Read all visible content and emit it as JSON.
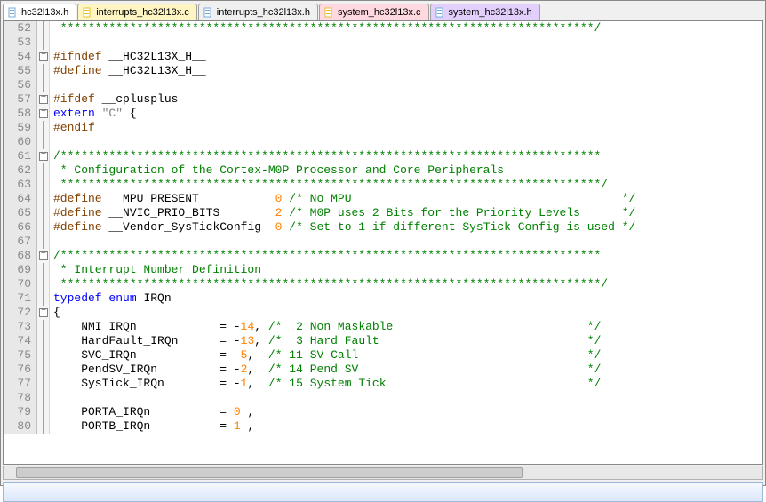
{
  "tabs": [
    {
      "label": "hc32l13x.h",
      "cls": "active",
      "iconColor": "#7aa8d8"
    },
    {
      "label": "interrupts_hc32l13x.c",
      "cls": "yellow",
      "iconColor": "#e0c030"
    },
    {
      "label": "interrupts_hc32l13x.h",
      "cls": "",
      "iconColor": "#7aa8d8"
    },
    {
      "label": "system_hc32l13x.c",
      "cls": "red",
      "iconColor": "#e0c030"
    },
    {
      "label": "system_hc32l13x.h",
      "cls": "purple",
      "iconColor": "#7aa8d8"
    }
  ],
  "lines": [
    {
      "n": 52,
      "f": "pipe",
      "html": "<span class='c-comment'> *****************************************************************************/</span>"
    },
    {
      "n": 53,
      "f": "pipe",
      "html": ""
    },
    {
      "n": 54,
      "f": "box",
      "html": "<span class='c-pp'>#ifndef</span> <span class='c-ident'>__HC32L13X_H__</span>"
    },
    {
      "n": 55,
      "f": "pipe",
      "html": "<span class='c-pp'>#define</span> <span class='c-ident'>__HC32L13X_H__</span>"
    },
    {
      "n": 56,
      "f": "pipe",
      "html": ""
    },
    {
      "n": 57,
      "f": "box",
      "html": "<span class='c-pp'>#ifdef</span> <span class='c-ident'>__cplusplus</span>"
    },
    {
      "n": 58,
      "f": "box",
      "html": "<span class='c-kw'>extern</span> <span class='c-str'>\"C\"</span> <span class='c-ident'>{</span>"
    },
    {
      "n": 59,
      "f": "pipe",
      "html": "<span class='c-pp'>#endif</span>"
    },
    {
      "n": 60,
      "f": "pipe",
      "html": ""
    },
    {
      "n": 61,
      "f": "box",
      "html": "<span class='c-comment'>/******************************************************************************</span>"
    },
    {
      "n": 62,
      "f": "pipe",
      "html": "<span class='c-comment'> * Configuration of the Cortex-M0P Processor and Core Peripherals</span>"
    },
    {
      "n": 63,
      "f": "pipe",
      "html": "<span class='c-comment'> ******************************************************************************/</span>"
    },
    {
      "n": 64,
      "f": "pipe",
      "html": "<span class='c-pp'>#define</span> <span class='c-ident'>__MPU_PRESENT           </span><span class='c-num'>0</span> <span class='c-comment'>/* No MPU                                       */</span>"
    },
    {
      "n": 65,
      "f": "pipe",
      "html": "<span class='c-pp'>#define</span> <span class='c-ident'>__NVIC_PRIO_BITS        </span><span class='c-num'>2</span> <span class='c-comment'>/* M0P uses 2 Bits for the Priority Levels      */</span>"
    },
    {
      "n": 66,
      "f": "pipe",
      "html": "<span class='c-pp'>#define</span> <span class='c-ident'>__Vendor_SysTickConfig  </span><span class='c-num'>0</span> <span class='c-comment'>/* Set to 1 if different SysTick Config is used */</span>"
    },
    {
      "n": 67,
      "f": "pipe",
      "html": ""
    },
    {
      "n": 68,
      "f": "box",
      "html": "<span class='c-comment'>/******************************************************************************</span>"
    },
    {
      "n": 69,
      "f": "pipe",
      "html": "<span class='c-comment'> * Interrupt Number Definition</span>"
    },
    {
      "n": 70,
      "f": "pipe",
      "html": "<span class='c-comment'> ******************************************************************************/</span>"
    },
    {
      "n": 71,
      "f": "pipe",
      "html": "<span class='c-kw'>typedef</span> <span class='c-kw'>enum</span> <span class='c-ident'>IRQn</span>"
    },
    {
      "n": 72,
      "f": "box",
      "html": "<span class='c-ident'>{</span>"
    },
    {
      "n": 73,
      "f": "pipe",
      "html": "<span class='c-ident'>    NMI_IRQn            </span><span class='c-ident'>=</span> <span class='c-ident'>-</span><span class='c-num'>14</span><span class='c-ident'>,</span> <span class='c-comment'>/*  2 Non Maskable                            */</span>"
    },
    {
      "n": 74,
      "f": "pipe",
      "html": "<span class='c-ident'>    HardFault_IRQn      </span><span class='c-ident'>=</span> <span class='c-ident'>-</span><span class='c-num'>13</span><span class='c-ident'>,</span> <span class='c-comment'>/*  3 Hard Fault                              */</span>"
    },
    {
      "n": 75,
      "f": "pipe",
      "html": "<span class='c-ident'>    SVC_IRQn            </span><span class='c-ident'>=</span> <span class='c-ident'>-</span><span class='c-num'>5</span><span class='c-ident'>,</span>  <span class='c-comment'>/* 11 SV Call                                 */</span>"
    },
    {
      "n": 76,
      "f": "pipe",
      "html": "<span class='c-ident'>    PendSV_IRQn         </span><span class='c-ident'>=</span> <span class='c-ident'>-</span><span class='c-num'>2</span><span class='c-ident'>,</span>  <span class='c-comment'>/* 14 Pend SV                                 */</span>"
    },
    {
      "n": 77,
      "f": "pipe",
      "html": "<span class='c-ident'>    SysTick_IRQn        </span><span class='c-ident'>=</span> <span class='c-ident'>-</span><span class='c-num'>1</span><span class='c-ident'>,</span>  <span class='c-comment'>/* 15 System Tick                             */</span>"
    },
    {
      "n": 78,
      "f": "pipe",
      "html": ""
    },
    {
      "n": 79,
      "f": "pipe",
      "html": "<span class='c-ident'>    PORTA_IRQn          </span><span class='c-ident'>=</span> <span class='c-num'>0</span> <span class='c-ident'>,</span>"
    },
    {
      "n": 80,
      "f": "pipe",
      "html": "<span class='c-ident'>    PORTB_IRQn          </span><span class='c-ident'>=</span> <span class='c-num'>1</span> <span class='c-ident'>,</span>"
    }
  ]
}
